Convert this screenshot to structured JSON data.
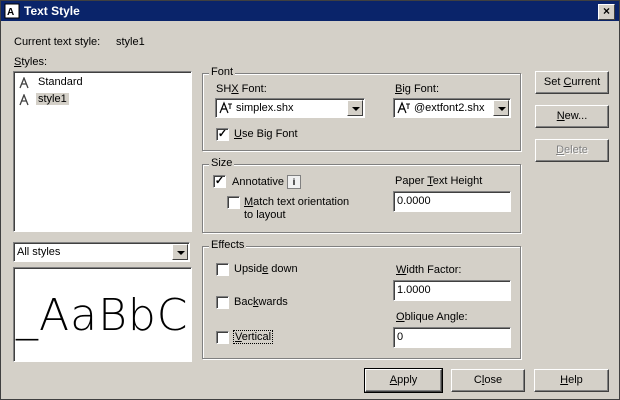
{
  "window": {
    "title": "Text Style",
    "close_glyph": "×"
  },
  "current_style": {
    "label": "Current text style:",
    "value": "style1"
  },
  "styles": {
    "label": "Styles:",
    "items": [
      {
        "label": "Standard",
        "icon": "annotative-text-icon"
      },
      {
        "label": "style1",
        "icon": "annotative-text-icon",
        "selected": true
      }
    ],
    "filter": {
      "value": "All styles"
    },
    "preview_text": "_AaBbCc"
  },
  "font": {
    "legend": "Font",
    "shx_label": "SHX Font:",
    "shx_value": "simplex.shx",
    "big_label": "Big Font:",
    "big_value": "@extfont2.shx",
    "use_big_font": {
      "label": "Use Big Font",
      "checked": true
    }
  },
  "size": {
    "legend": "Size",
    "annotative": {
      "label": "Annotative",
      "checked": true,
      "info_glyph": "i"
    },
    "match_orientation": {
      "line1": "Match text orientation",
      "line2": "to layout",
      "checked": false
    },
    "paper_height": {
      "label": "Paper Text Height",
      "value": "0.0000"
    }
  },
  "effects": {
    "legend": "Effects",
    "upside_down": {
      "label": "Upside down",
      "checked": false
    },
    "backwards": {
      "label": "Backwards",
      "checked": false
    },
    "vertical": {
      "label": "Vertical",
      "checked": false
    },
    "width_factor": {
      "label": "Width Factor:",
      "value": "1.0000"
    },
    "oblique_angle": {
      "label": "Oblique Angle:",
      "value": "0"
    }
  },
  "buttons": {
    "set_current": "Set Current",
    "new": "New...",
    "delete": "Delete",
    "apply": "Apply",
    "close": "Close",
    "help": "Help"
  },
  "colors": {
    "titlebar": "#0a246a",
    "face": "#d4d0c8"
  }
}
